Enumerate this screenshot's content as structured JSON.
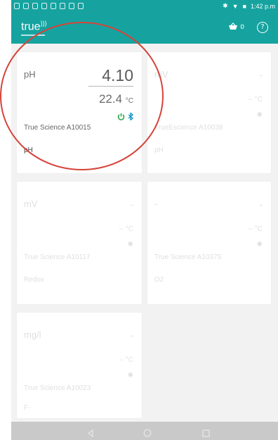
{
  "status_bar": {
    "time": "1:42 p.m",
    "icons": [
      "notification-icon",
      "notification-icon",
      "notification-icon",
      "notification-icon",
      "notification-icon",
      "notification-icon",
      "notification-icon",
      "notification-icon"
    ]
  },
  "app_bar": {
    "logo": "true",
    "basket_count": "0",
    "help_icon": "?"
  },
  "cards": [
    {
      "unit": "pH",
      "value": "4.10",
      "temp": "22.4",
      "temp_unit": "°C",
      "device": "True Science A10015",
      "param": "pH",
      "active": true
    },
    {
      "unit": "mV",
      "value": "-",
      "temp": "--",
      "temp_unit": "°C",
      "device": "TrueEscience A10038",
      "param": "pH",
      "active": false
    },
    {
      "unit": "mV",
      "value": "-",
      "temp": "--",
      "temp_unit": "°C",
      "device": "True Science A10117",
      "param": "Redox",
      "active": false
    },
    {
      "unit": "-",
      "value": "-",
      "temp": "--",
      "temp_unit": "°C",
      "device": "True Science A10375",
      "param": "O2",
      "active": false
    },
    {
      "unit": "mg/l",
      "value": "-",
      "temp": "--",
      "temp_unit": "°C",
      "device": "True Science A10023",
      "param": "F-",
      "active": false
    }
  ],
  "colors": {
    "accent": "#16a3a0",
    "highlight": "#d5443a",
    "power_icon": "#2ea84f",
    "bluetooth_icon": "#1a97c9"
  },
  "nav_icons": [
    "back-icon",
    "home-icon",
    "recents-icon"
  ]
}
